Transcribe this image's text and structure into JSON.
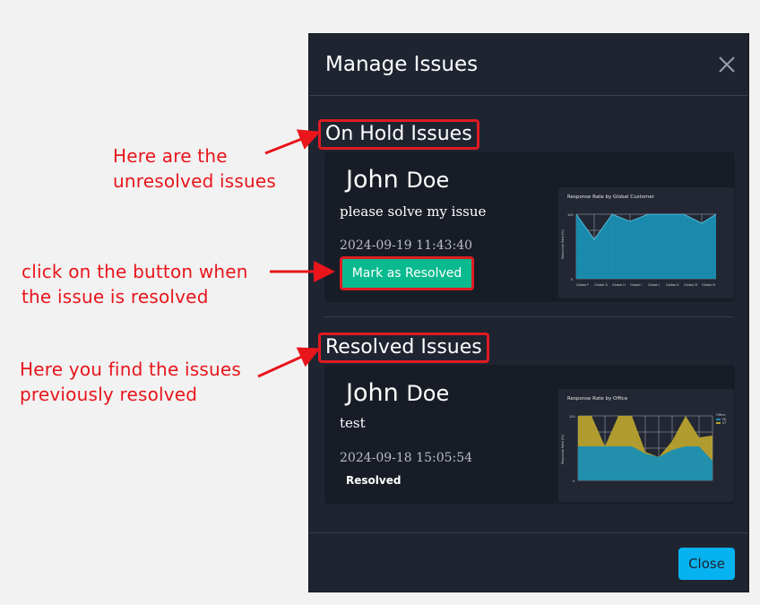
{
  "annotations": {
    "unresolved": [
      "Here are the",
      "unresolved issues"
    ],
    "button": [
      "click on the button when",
      "the issue is resolved"
    ],
    "resolved": [
      "Here you find the issues",
      "previously resolved"
    ]
  },
  "modal": {
    "title": "Manage Issues",
    "close_icon": "close-icon",
    "on_hold_title": "On Hold Issues",
    "resolved_title": "Resolved Issues",
    "close_label": "Close"
  },
  "on_hold": {
    "name_first": "John",
    "name_last": "Doe",
    "message": "please solve my issue",
    "date": "2024-09-19 11:43:40",
    "button": "Mark as Resolved",
    "chart_title": "Response Rate by Global Customer"
  },
  "resolved": {
    "name_first": "John",
    "name_last": "Doe",
    "message": "test",
    "date": "2024-09-18 15:05:54",
    "status": "Resolved",
    "chart_title": "Response Rate by Office"
  },
  "colors": {
    "accent_green": "#0aba8f",
    "accent_blue": "#06b3f0",
    "annotation_red": "#e8151b",
    "area_teal": "#1a8fb3",
    "area_gold": "#b8a22e"
  }
}
